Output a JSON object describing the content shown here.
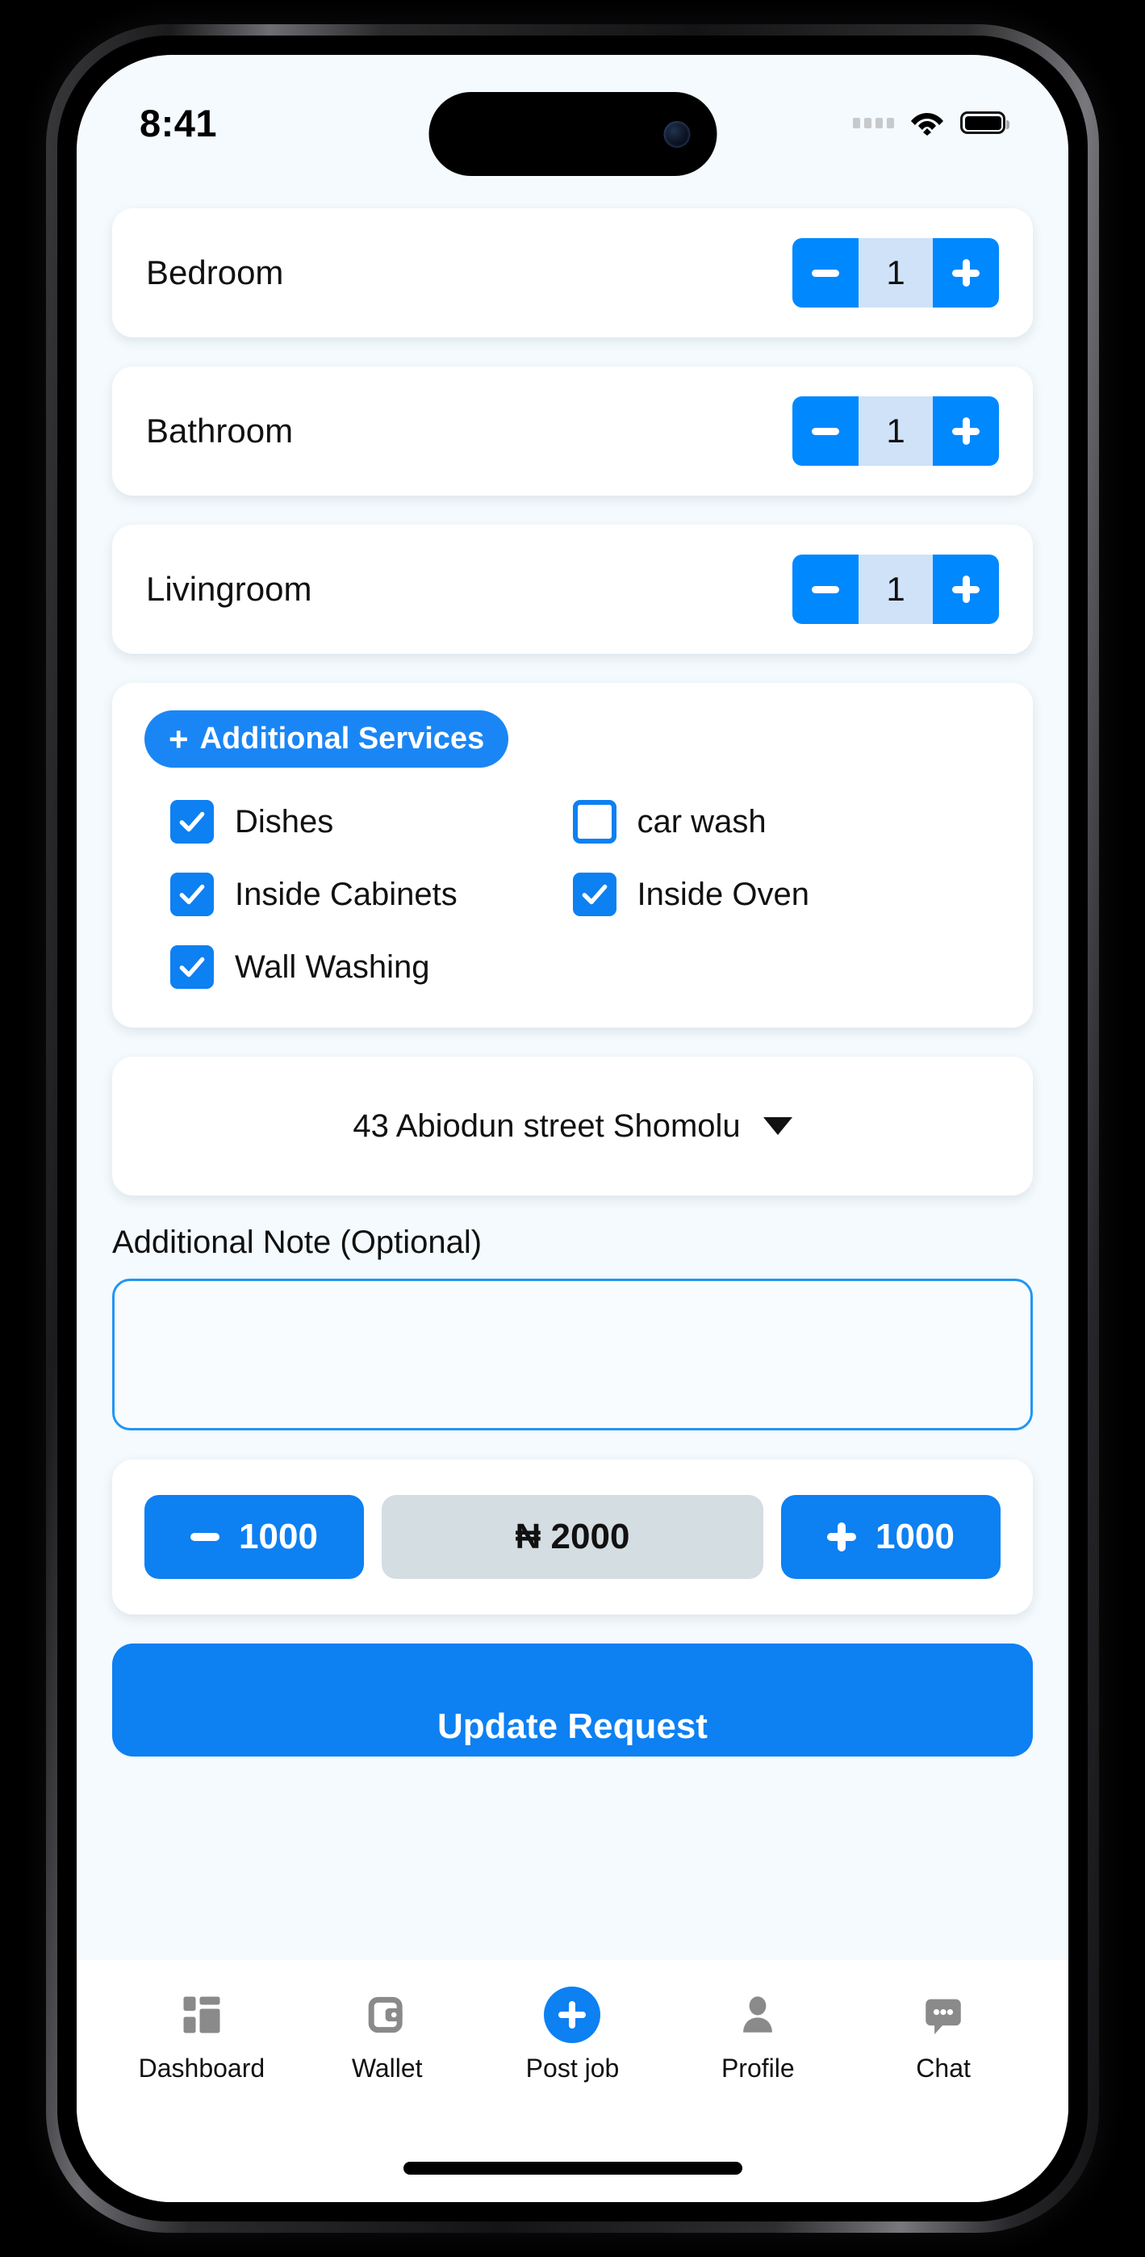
{
  "status_bar": {
    "time": "8:41",
    "signal_icon": "signal-dots-icon",
    "wifi_icon": "wifi-icon",
    "battery_icon": "battery-icon"
  },
  "rooms": [
    {
      "label": "Bedroom",
      "count": "1",
      "minus": "minus-icon",
      "plus": "plus-icon"
    },
    {
      "label": "Bathroom",
      "count": "1",
      "minus": "minus-icon",
      "plus": "plus-icon"
    },
    {
      "label": "Livingroom",
      "count": "1",
      "minus": "minus-icon",
      "plus": "plus-icon"
    }
  ],
  "services": {
    "pill_plus": "+",
    "pill_label": "Additional Services",
    "items": [
      {
        "label": "Dishes",
        "checked": true
      },
      {
        "label": "car wash",
        "checked": false
      },
      {
        "label": "Inside Cabinets",
        "checked": true
      },
      {
        "label": "Inside Oven",
        "checked": true
      },
      {
        "label": "Wall Washing",
        "checked": true
      }
    ]
  },
  "address": {
    "selected": "43 Abiodun street Shomolu",
    "caret_icon": "chevron-down-icon"
  },
  "note": {
    "label": "Additional Note (Optional)",
    "value": "",
    "placeholder": ""
  },
  "price": {
    "decrement_label": "1000",
    "increment_label": "1000",
    "amount": "₦ 2000"
  },
  "submit": {
    "label": "Update Request"
  },
  "bottom_nav": [
    {
      "label": "Dashboard",
      "icon": "dashboard-grid-icon"
    },
    {
      "label": "Wallet",
      "icon": "wallet-icon"
    },
    {
      "label": "Post job",
      "icon": "plus-circle-icon"
    },
    {
      "label": "Profile",
      "icon": "person-icon"
    },
    {
      "label": "Chat",
      "icon": "chat-bubble-icon"
    }
  ],
  "colors": {
    "accent": "#0d80f2",
    "accent_bright": "#0088ff",
    "stepper_value_bg": "#cfe2f7",
    "price_value_bg": "#d4dde1",
    "app_bg": "#f4fafd",
    "nav_inactive": "#8a8a8a"
  }
}
